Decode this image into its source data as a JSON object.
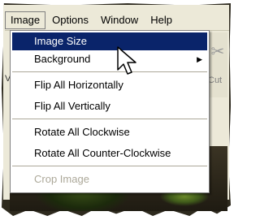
{
  "menubar": {
    "items": [
      {
        "label": "Image",
        "open": true
      },
      {
        "label": "Options"
      },
      {
        "label": "Window"
      },
      {
        "label": "Help"
      }
    ]
  },
  "image_menu": {
    "items": [
      {
        "label": "Image Size",
        "state": "highlighted"
      },
      {
        "label": "Background",
        "submenu": true,
        "arrow": "▶"
      },
      {
        "label": "Flip All Horizontally"
      },
      {
        "label": "Flip All Vertically"
      },
      {
        "label": "Rotate All Clockwise"
      },
      {
        "label": "Rotate All Counter-Clockwise"
      },
      {
        "label": "Crop Image",
        "state": "disabled"
      }
    ]
  },
  "toolbar": {
    "cut_label": "Cut",
    "cut_icon": "scissors-icon"
  },
  "partial_left_text": "V",
  "colors": {
    "highlight": "#0a246a",
    "menu_bg": "#ffffff",
    "chrome": "#ece9d8",
    "disabled_text": "#aca899"
  }
}
